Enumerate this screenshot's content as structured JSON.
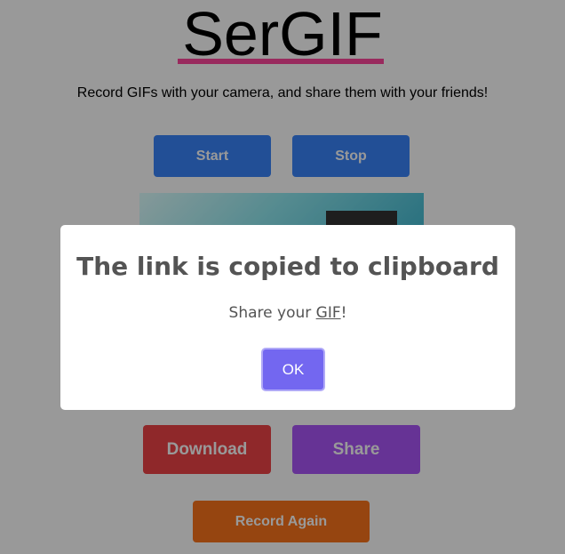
{
  "app": {
    "title": "SerGIF",
    "subtitle": "Record GIFs with your camera, and share them with your friends!"
  },
  "controls": {
    "start": "Start",
    "stop": "Stop",
    "download": "Download",
    "share": "Share",
    "record_again": "Record Again"
  },
  "modal": {
    "title": "The link is copied to clipboard",
    "text_prefix": "Share your ",
    "text_link": "GIF",
    "text_suffix": "!",
    "ok": "OK"
  },
  "colors": {
    "start": "#3a84fa",
    "download": "#ef4346",
    "share": "#aa55f8",
    "record_again": "#fa731b",
    "ok": "#7367f0",
    "accent": "#ff469d"
  }
}
